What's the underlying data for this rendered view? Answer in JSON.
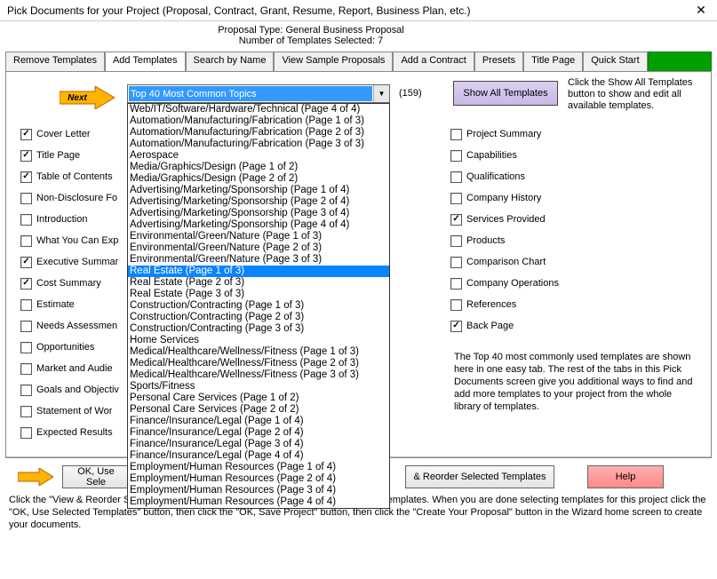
{
  "window": {
    "title": "Pick Documents for your Project (Proposal, Contract, Grant, Resume, Report, Business Plan, etc.)"
  },
  "header": {
    "proposal_type_label": "Proposal Type:",
    "proposal_type_value": "General Business Proposal",
    "num_selected_label": "Number of Templates Selected:",
    "num_selected_value": "7"
  },
  "tabs": [
    "Remove Templates",
    "Add Templates",
    "Search by Name",
    "View Sample Proposals",
    "Add a Contract",
    "Presets",
    "Title Page",
    "Quick Start"
  ],
  "active_tab_index": 1,
  "next_label": "Next",
  "dropdown": {
    "selected": "Top 40 Most Common Topics",
    "count": "(159)",
    "highlight_index": 13,
    "options": [
      "Web/IT/Software/Hardware/Technical (Page 4 of 4)",
      "Automation/Manufacturing/Fabrication (Page 1 of 3)",
      "Automation/Manufacturing/Fabrication (Page 2 of 3)",
      "Automation/Manufacturing/Fabrication (Page 3 of 3)",
      "Aerospace",
      "Media/Graphics/Design (Page 1 of 2)",
      "Media/Graphics/Design (Page 2 of 2)",
      "Advertising/Marketing/Sponsorship (Page 1 of 4)",
      "Advertising/Marketing/Sponsorship (Page 2 of 4)",
      "Advertising/Marketing/Sponsorship (Page 3 of 4)",
      "Advertising/Marketing/Sponsorship (Page 4 of 4)",
      "Environmental/Green/Nature (Page 1 of 3)",
      "Environmental/Green/Nature (Page 2 of 3)",
      "Environmental/Green/Nature (Page 3 of 3)",
      "Real Estate (Page 1 of 3)",
      "Real Estate (Page 2 of 3)",
      "Real Estate (Page 3 of 3)",
      "Construction/Contracting (Page 1 of 3)",
      "Construction/Contracting (Page 2 of 3)",
      "Construction/Contracting (Page 3 of 3)",
      "Home Services",
      "Medical/Healthcare/Wellness/Fitness (Page 1 of 3)",
      "Medical/Healthcare/Wellness/Fitness (Page 2 of 3)",
      "Medical/Healthcare/Wellness/Fitness (Page 3 of 3)",
      "Sports/Fitness",
      "Personal Care Services (Page 1 of 2)",
      "Personal Care Services (Page 2 of 2)",
      "Finance/Insurance/Legal (Page 1 of 4)",
      "Finance/Insurance/Legal (Page 2 of 4)",
      "Finance/Insurance/Legal (Page 3 of 4)",
      "Finance/Insurance/Legal (Page 4 of 4)",
      "Employment/Human Resources (Page 1 of 4)",
      "Employment/Human Resources (Page 2 of 4)",
      "Employment/Human Resources (Page 3 of 4)",
      "Employment/Human Resources (Page 4 of 4)"
    ]
  },
  "show_all": {
    "button": "Show All Templates",
    "hint": "Click the Show All Templates button to show and edit all available templates."
  },
  "left_checks": [
    {
      "label": "Cover Letter",
      "checked": true
    },
    {
      "label": "Title Page",
      "checked": true
    },
    {
      "label": "Table of Contents",
      "checked": true
    },
    {
      "label": "Non-Disclosure Fo",
      "checked": false
    },
    {
      "label": "Introduction",
      "checked": false
    },
    {
      "label": "What You Can Exp",
      "checked": false
    },
    {
      "label": "Executive Summar",
      "checked": true
    },
    {
      "label": "Cost Summary",
      "checked": true
    },
    {
      "label": "Estimate",
      "checked": false
    },
    {
      "label": "Needs Assessmen",
      "checked": false
    },
    {
      "label": "Opportunities",
      "checked": false
    },
    {
      "label": "Market and Audie",
      "checked": false
    },
    {
      "label": "Goals and Objectiv",
      "checked": false
    },
    {
      "label": "Statement of Wor",
      "checked": false
    },
    {
      "label": "Expected Results",
      "checked": false
    }
  ],
  "right_checks": [
    {
      "label": "Project Summary",
      "checked": false
    },
    {
      "label": "Capabilities",
      "checked": false
    },
    {
      "label": "Qualifications",
      "checked": false
    },
    {
      "label": "Company History",
      "checked": false
    },
    {
      "label": "Services Provided",
      "checked": true
    },
    {
      "label": "Products",
      "checked": false
    },
    {
      "label": "Comparison Chart",
      "checked": false
    },
    {
      "label": "Company Operations",
      "checked": false
    },
    {
      "label": "References",
      "checked": false
    },
    {
      "label": "Back Page",
      "checked": true
    }
  ],
  "top40_text": "The Top 40 most commonly used templates are shown here in one easy tab.  The rest of the tabs in this Pick Documents screen give you additional ways to find and add more templates to your project from the whole library of templates.",
  "buttons": {
    "ok": "OK, Use Sele",
    "view_reorder": "& Reorder Selected Templates",
    "help": "Help"
  },
  "footer": "Click the \"View & Reorder Selected Templates\" button for a list of all currently selected templates.  When you are done selecting templates for this project click the \"OK, Use Selected Templates\" button, then click the \"OK, Save Project\" button, then click the \"Create Your Proposal\" button in the Wizard home screen to create your documents."
}
